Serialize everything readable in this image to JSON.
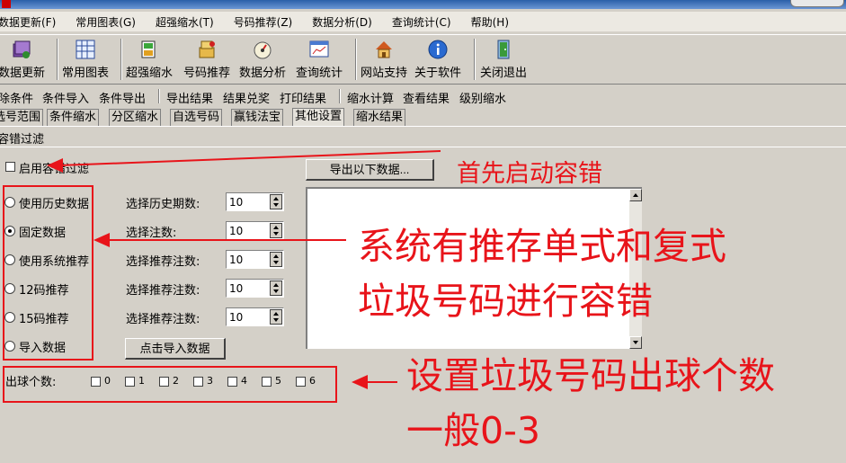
{
  "menubar": {
    "items": [
      "数据更新(F)",
      "常用图表(G)",
      "超强缩水(T)",
      "号码推荐(Z)",
      "数据分析(D)",
      "查询统计(C)",
      "帮助(H)"
    ]
  },
  "toolbar": {
    "items": [
      {
        "label": "数据更新",
        "icon": "database-update-icon"
      },
      {
        "label": "常用图表",
        "icon": "chart-grid-icon"
      },
      {
        "label": "超强缩水",
        "icon": "reduce-icon"
      },
      {
        "label": "号码推荐",
        "icon": "recommend-icon"
      },
      {
        "label": "数据分析",
        "icon": "analysis-icon"
      },
      {
        "label": "查询统计",
        "icon": "statistics-icon"
      },
      {
        "label": "网站支持",
        "icon": "home-icon"
      },
      {
        "label": "关于软件",
        "icon": "info-icon"
      },
      {
        "label": "关闭退出",
        "icon": "exit-door-icon"
      }
    ]
  },
  "subtoolbar": {
    "items": [
      "除条件",
      "条件导入",
      "条件导出",
      "导出结果",
      "结果兑奖",
      "打印结果",
      "缩水计算",
      "查看结果",
      "级别缩水"
    ]
  },
  "tabs": [
    "选号范围",
    "条件缩水",
    "分区缩水",
    "自选号码",
    "赢钱法宝",
    "其他设置",
    "缩水结果"
  ],
  "panel": {
    "title": "容错过滤",
    "enable_label": "启用容错过滤",
    "export_button": "导出以下数据...",
    "import_button": "点击导入数据",
    "options": [
      {
        "label": "使用历史数据",
        "field_label": "选择历史期数:",
        "value": "10",
        "selected": false
      },
      {
        "label": "固定数据",
        "field_label": "选择注数:",
        "value": "10",
        "selected": true
      },
      {
        "label": "使用系统推荐",
        "field_label": "选择推荐注数:",
        "value": "10",
        "selected": false
      },
      {
        "label": "12码推荐",
        "field_label": "选择推荐注数:",
        "value": "10",
        "selected": false
      },
      {
        "label": "15码推荐",
        "field_label": "选择推荐注数:",
        "value": "10",
        "selected": false
      },
      {
        "label": "导入数据",
        "selected": false
      }
    ],
    "ball_count_label": "出球个数:",
    "ball_counts": [
      "0",
      "1",
      "2",
      "3",
      "4",
      "5",
      "6"
    ]
  },
  "annotations": {
    "first": "首先启动容错",
    "second_line1": "系统有推存单式和复式",
    "second_line2": "垃圾号码进行容错",
    "third_line1": "设置垃圾号码出球个数",
    "third_line2": "一般0-3",
    "color": "#e8141a"
  }
}
